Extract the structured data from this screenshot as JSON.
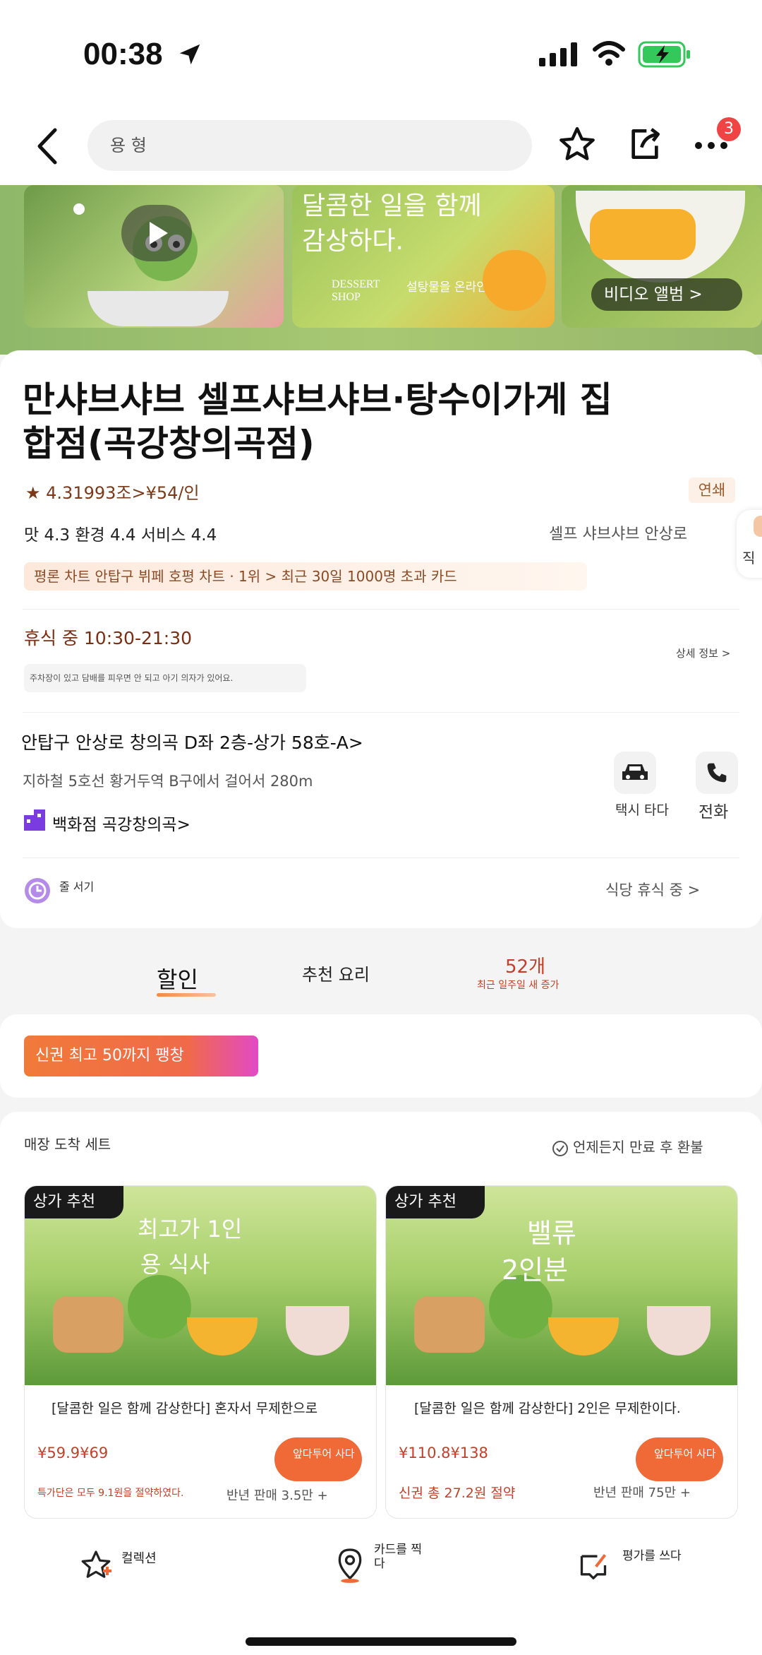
{
  "status_bar": {
    "time": "00:38",
    "battery_color": "#34c759"
  },
  "nav": {
    "search_text": "용 형",
    "badge_count": "3"
  },
  "banner": {
    "tile2_line1": "달콤한 일을 함께",
    "tile2_line2": "감상하다.",
    "tile2_small": "DESSERT SHOP",
    "tile2_caption": "설탕물을 온라인에 걸다.",
    "video_album": "비디오 앨범 >"
  },
  "store": {
    "name_line1": "만샤브샤브 셀프샤브샤브·탕수이가게 집",
    "name_line2": "합점(곡강창의곡점)",
    "rating_line": "★ 4.31993조>¥54/인",
    "chain_badge": "연쇄",
    "scores": "맛 4.3 환경 4.4 서비스 4.4",
    "category": "셀프 샤브샤브 안상로",
    "ranking": "평론 차트 안탑구 뷔페 호평 차트 · 1위 > 최근 30일 1000명 초과 카드",
    "hours": "휴식 중 10:30-21:30",
    "details_link": "상세 정보 >",
    "notice": "주차장이 있고 담배를 피우면 안 되고 아기 의자가 있어요.",
    "address": "안탑구 안상로 창의곡 D좌 2층-상가 58호-A>",
    "subway": "지하철 5호선 황거두역 B구에서 걸어서 280m",
    "mall": "백화점 곡강창의곡>",
    "taxi_label": "택시 타다",
    "phone_label": "전화",
    "queue_label": "줄 서기",
    "queue_status": "식당 휴식 중 >",
    "side_label": "직"
  },
  "tabs": [
    {
      "label": "할인"
    },
    {
      "label": "추천 요리"
    },
    {
      "label": "52개",
      "sub": "최근 일주일 새 증가"
    }
  ],
  "coupon": {
    "label": "신권 최고 50까지 팽창"
  },
  "sets": {
    "title": "매장 도착 세트",
    "refund": "언제든지 만료 후 환불",
    "items": [
      {
        "tag": "상가 추천",
        "overlay_line1": "최고가 1인",
        "overlay_line2": "용 식사",
        "name": "[달콤한 일은 함께 감상한다] 혼자서 무제한으로",
        "price": "¥59.9¥69",
        "buy": "앞다투어 사다",
        "saving": "특가단은 모두 9.1원을 절약하였다.",
        "sold": "반년 판매 3.5만 +"
      },
      {
        "tag": "상가 추천",
        "overlay_line1": "밸류",
        "overlay_line2": "2인분",
        "name": "[달콤한 일은 함께 감상한다] 2인은 무제한이다.",
        "price": "¥110.8¥138",
        "buy": "앞다투어 사다",
        "saving": "신권 총 27.2원 절약",
        "sold": "반년 판매 75만 +"
      }
    ]
  },
  "bottom": {
    "collect": "컬렉션",
    "checkin": "카드를 찍다",
    "review": "평가를 쓰다"
  }
}
